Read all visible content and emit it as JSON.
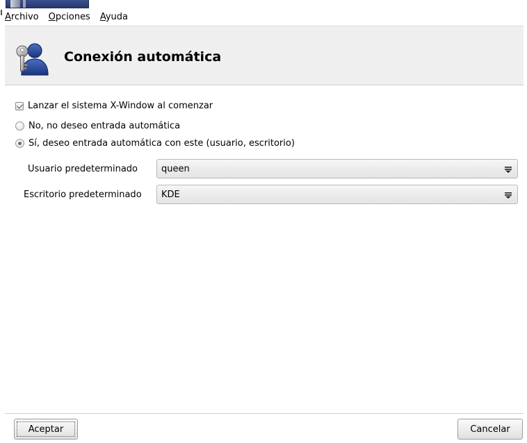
{
  "menubar": {
    "items": [
      {
        "mnemonic": "A",
        "rest": "rchivo"
      },
      {
        "mnemonic": "O",
        "rest": "pciones"
      },
      {
        "mnemonic": "A",
        "rest": "yuda"
      }
    ]
  },
  "header": {
    "title": "Conexión automática",
    "icon": "user-key-icon"
  },
  "options": {
    "launch_x": {
      "label": "Lanzar el sistema X-Window al comenzar",
      "checked": true
    },
    "radio_no": {
      "label": "No, no deseo entrada automática",
      "selected": false
    },
    "radio_yes": {
      "label": "Sí, deseo entrada automática con este (usuario, escritorio)",
      "selected": true
    }
  },
  "form": {
    "user_label": "Usuario predeterminado",
    "user_value": "queen",
    "desktop_label": "Escritorio predeterminado",
    "desktop_value": "KDE"
  },
  "buttons": {
    "ok": "Aceptar",
    "cancel": "Cancelar"
  },
  "colors": {
    "header_stripe": "#ebebeb",
    "icon_blue": "#1f3f8f"
  }
}
